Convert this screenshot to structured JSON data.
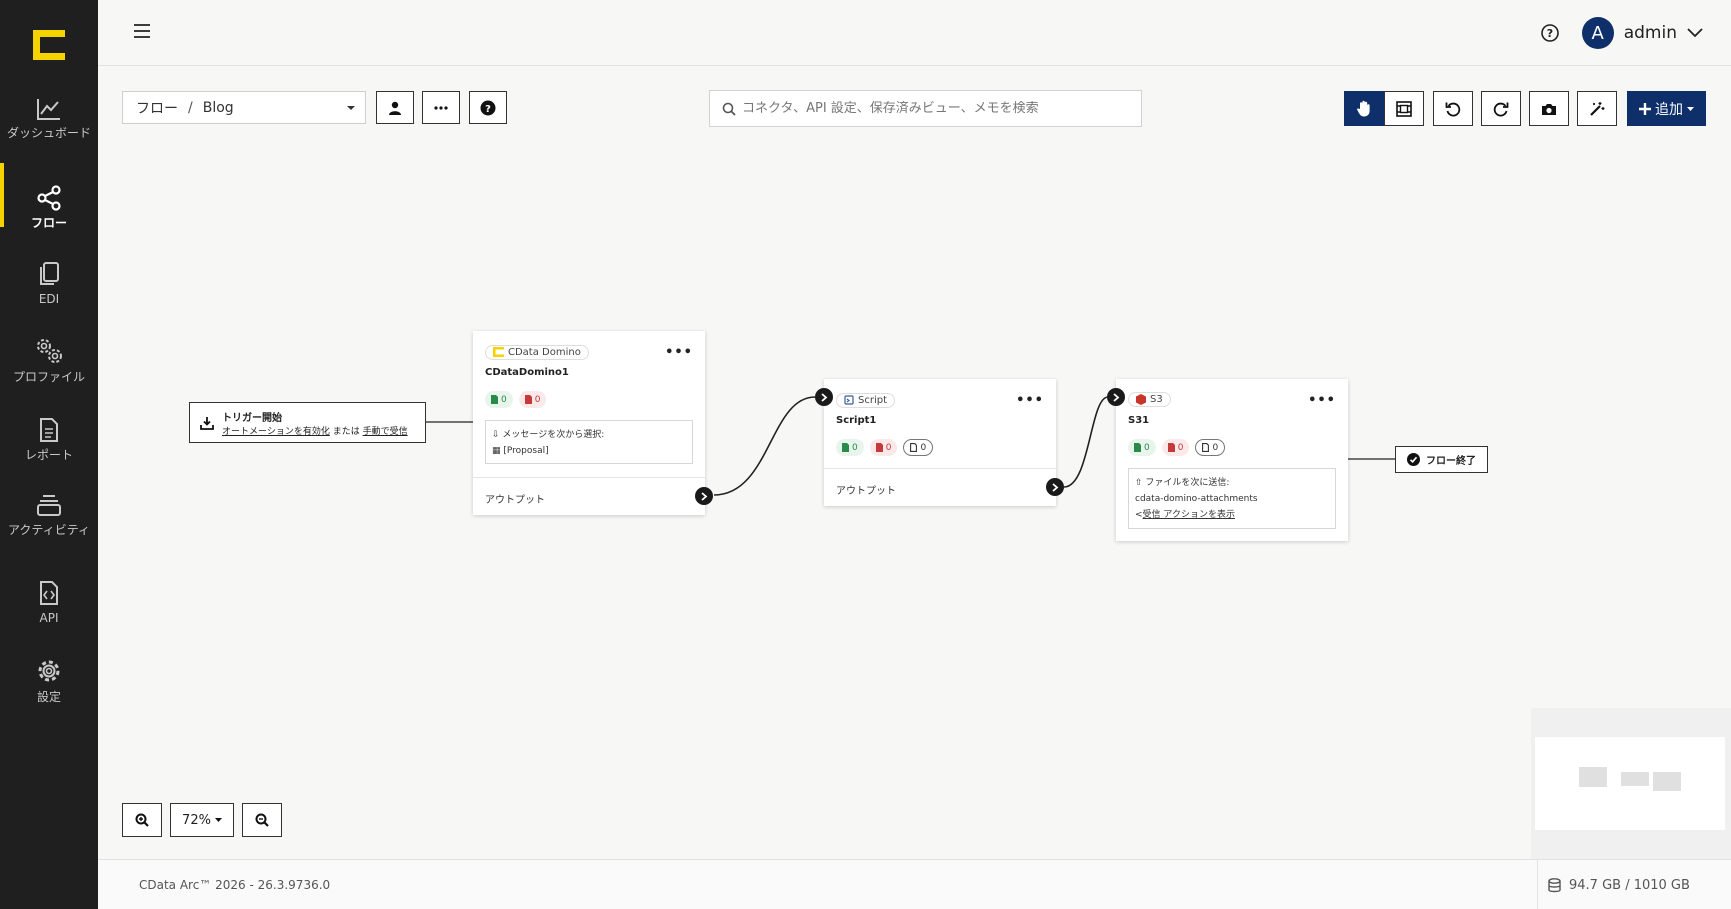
{
  "nav": {
    "items": [
      {
        "label": "ダッシュボード",
        "icon": "chart-line-icon"
      },
      {
        "label": "フロー",
        "icon": "share-nodes-icon",
        "active": true
      },
      {
        "label": "EDI",
        "icon": "documents-icon"
      },
      {
        "label": "プロファイル",
        "icon": "gears-icon"
      },
      {
        "label": "レポート",
        "icon": "report-file-icon"
      },
      {
        "label": "アクティビティ",
        "icon": "layers-icon"
      },
      {
        "label": "API",
        "icon": "api-file-icon"
      },
      {
        "label": "設定",
        "icon": "gear-icon"
      }
    ]
  },
  "header": {
    "user_initial": "A",
    "user_name": "admin"
  },
  "toolbar": {
    "breadcrumb_root": "フロー",
    "breadcrumb_sep": "/",
    "breadcrumb_current": "Blog",
    "search_placeholder": "コネクタ、API 設定、保存済みビュー、メモを検索",
    "add_label": "追加"
  },
  "canvas": {
    "trigger": {
      "title": "トリガー開始",
      "link1": "オートメーションを有効化",
      "mid": "または",
      "link2": "手動で受信"
    },
    "nodes": {
      "domino": {
        "type_label": "CData Domino",
        "name": "CDataDomino1",
        "green": "0",
        "red": "0",
        "info_label": "メッセージを次から選択:",
        "info_value": "[Proposal]",
        "output": "アウトプット"
      },
      "script": {
        "type_label": "Script",
        "name": "Script1",
        "green": "0",
        "red": "0",
        "neutral": "0",
        "output": "アウトプット"
      },
      "s3": {
        "type_label": "S3",
        "name": "S31",
        "green": "0",
        "red": "0",
        "neutral": "0",
        "info_label": "ファイルを次に送信:",
        "info_value": "cdata-domino-attachments",
        "info_link": "受信 アクションを表示"
      }
    },
    "flow_end": "フロー終了"
  },
  "zoom": {
    "level": "72%"
  },
  "footer": {
    "version": "CData Arc™ 2026 - 26.3.9736.0",
    "storage": "94.7 GB / 1010 GB"
  },
  "colors": {
    "sidebar": "#1f1f1f",
    "accent": "#f5d300",
    "primary": "#0f2f6b"
  }
}
